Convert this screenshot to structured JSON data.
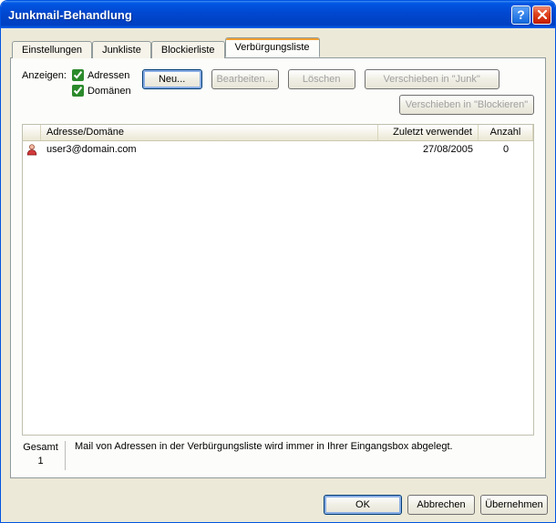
{
  "window": {
    "title": "Junkmail-Behandlung"
  },
  "tabs": [
    {
      "label": "Einstellungen",
      "active": false
    },
    {
      "label": "Junkliste",
      "active": false
    },
    {
      "label": "Blockierliste",
      "active": false
    },
    {
      "label": "Verbürgungsliste",
      "active": true
    }
  ],
  "show": {
    "label": "Anzeigen:",
    "addresses": {
      "label": "Adressen",
      "checked": true
    },
    "domains": {
      "label": "Domänen",
      "checked": true
    }
  },
  "buttons": {
    "new": "Neu...",
    "edit": "Bearbeiten...",
    "delete": "Löschen",
    "move_junk": "Verschieben in \"Junk\"",
    "move_block": "Verschieben in \"Blockieren\""
  },
  "table": {
    "headers": {
      "address": "Adresse/Domäne",
      "last_used": "Zuletzt verwendet",
      "count": "Anzahl"
    },
    "rows": [
      {
        "address": "user3@domain.com",
        "last_used": "27/08/2005",
        "count": "0"
      }
    ]
  },
  "footer": {
    "total_label": "Gesamt",
    "total_value": "1",
    "description": "Mail von Adressen in der Verbürgungsliste wird immer in Ihrer Eingangsbox abgelegt."
  },
  "dialog": {
    "ok": "OK",
    "cancel": "Abbrechen",
    "apply": "Übernehmen"
  }
}
